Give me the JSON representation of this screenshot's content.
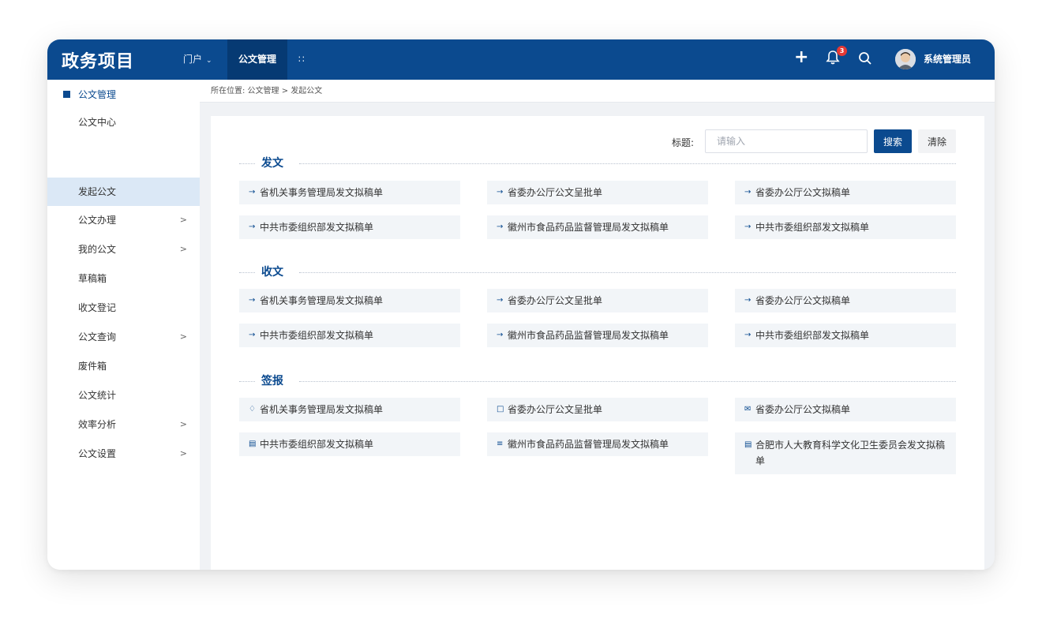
{
  "app": {
    "title": "政务项目"
  },
  "topnav": {
    "portal": "门户",
    "active": "公文管理",
    "grid_icon": "grid-icon",
    "badge_count": "3",
    "user_name": "系统管理员"
  },
  "sidebar": {
    "header": "公文管理",
    "items": [
      {
        "label": "公文中心",
        "has_arrow": false
      },
      {
        "label": "发起公文",
        "has_arrow": false,
        "active": true
      },
      {
        "label": "公文办理",
        "has_arrow": true
      },
      {
        "label": "我的公文",
        "has_arrow": true
      },
      {
        "label": "草稿箱",
        "has_arrow": false
      },
      {
        "label": "收文登记",
        "has_arrow": false
      },
      {
        "label": "公文查询",
        "has_arrow": true
      },
      {
        "label": "废件箱",
        "has_arrow": false
      },
      {
        "label": "公文统计",
        "has_arrow": false
      },
      {
        "label": "效率分析",
        "has_arrow": true
      },
      {
        "label": "公文设置",
        "has_arrow": true
      }
    ]
  },
  "breadcrumb": "所在位置: 公文管理 > 发起公文",
  "search": {
    "label": "标题:",
    "placeholder": "请输入",
    "value": "",
    "search_button": "搜索",
    "clear_button": "清除"
  },
  "sections": [
    {
      "title": "发文",
      "items": [
        {
          "label": "省机关事务管理局发文拟稿单",
          "icon": "arrow-right-icon"
        },
        {
          "label": "省委办公厅公文呈批单",
          "icon": "arrow-right-icon"
        },
        {
          "label": "省委办公厅公文拟稿单",
          "icon": "arrow-right-icon"
        },
        {
          "label": "中共市委组织部发文拟稿单",
          "icon": "arrow-right-icon"
        },
        {
          "label": "徽州市食品药品监督管理局发文拟稿单",
          "icon": "arrow-right-icon"
        },
        {
          "label": "中共市委组织部发文拟稿单",
          "icon": "arrow-right-icon"
        }
      ]
    },
    {
      "title": "收文",
      "items": [
        {
          "label": "省机关事务管理局发文拟稿单",
          "icon": "arrow-right-icon"
        },
        {
          "label": "省委办公厅公文呈批单",
          "icon": "arrow-right-icon"
        },
        {
          "label": "省委办公厅公文拟稿单",
          "icon": "arrow-right-icon"
        },
        {
          "label": "中共市委组织部发文拟稿单",
          "icon": "arrow-right-icon"
        },
        {
          "label": "徽州市食品药品监督管理局发文拟稿单",
          "icon": "arrow-right-icon"
        },
        {
          "label": "中共市委组织部发文拟稿单",
          "icon": "arrow-right-icon"
        }
      ]
    },
    {
      "title": "签报",
      "items": [
        {
          "label": "省机关事务管理局发文拟稿单",
          "icon": "layers-icon"
        },
        {
          "label": "省委办公厅公文呈批单",
          "icon": "message-icon"
        },
        {
          "label": "省委办公厅公文拟稿单",
          "icon": "mail-icon"
        },
        {
          "label": "中共市委组织部发文拟稿单",
          "icon": "clipboard-icon"
        },
        {
          "label": "徽州市食品药品监督管理局发文拟稿单",
          "icon": "user-list-icon"
        },
        {
          "label": "合肥市人大教育科学文化卫生委员会发文拟稿单",
          "icon": "list-icon"
        }
      ]
    }
  ]
}
